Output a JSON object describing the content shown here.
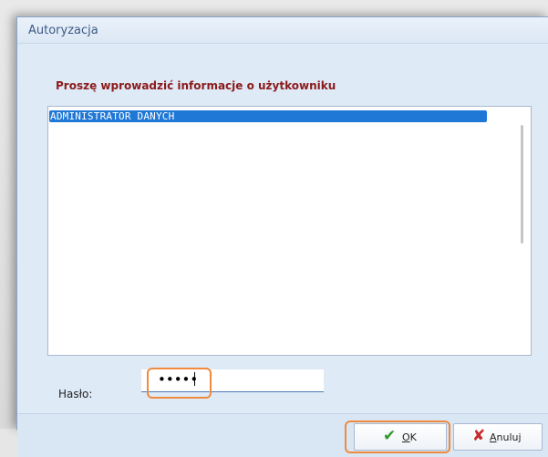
{
  "window": {
    "title": "Autoryzacja"
  },
  "prompt": "Proszę wprowadzić informacje o użytkowniku",
  "users": {
    "items": [
      "ADMINISTRATOR DANYCH"
    ],
    "selected_index": 0
  },
  "password": {
    "label": "Hasło:",
    "masked_value": "•••••"
  },
  "buttons": {
    "ok_label": "OK",
    "cancel_label": "Anuluj",
    "ok_icon": "checkmark-icon",
    "cancel_icon": "x-icon"
  },
  "colors": {
    "selection": "#1f78d6",
    "prompt_text": "#8b1a1a",
    "highlight": "#f08a3c"
  }
}
